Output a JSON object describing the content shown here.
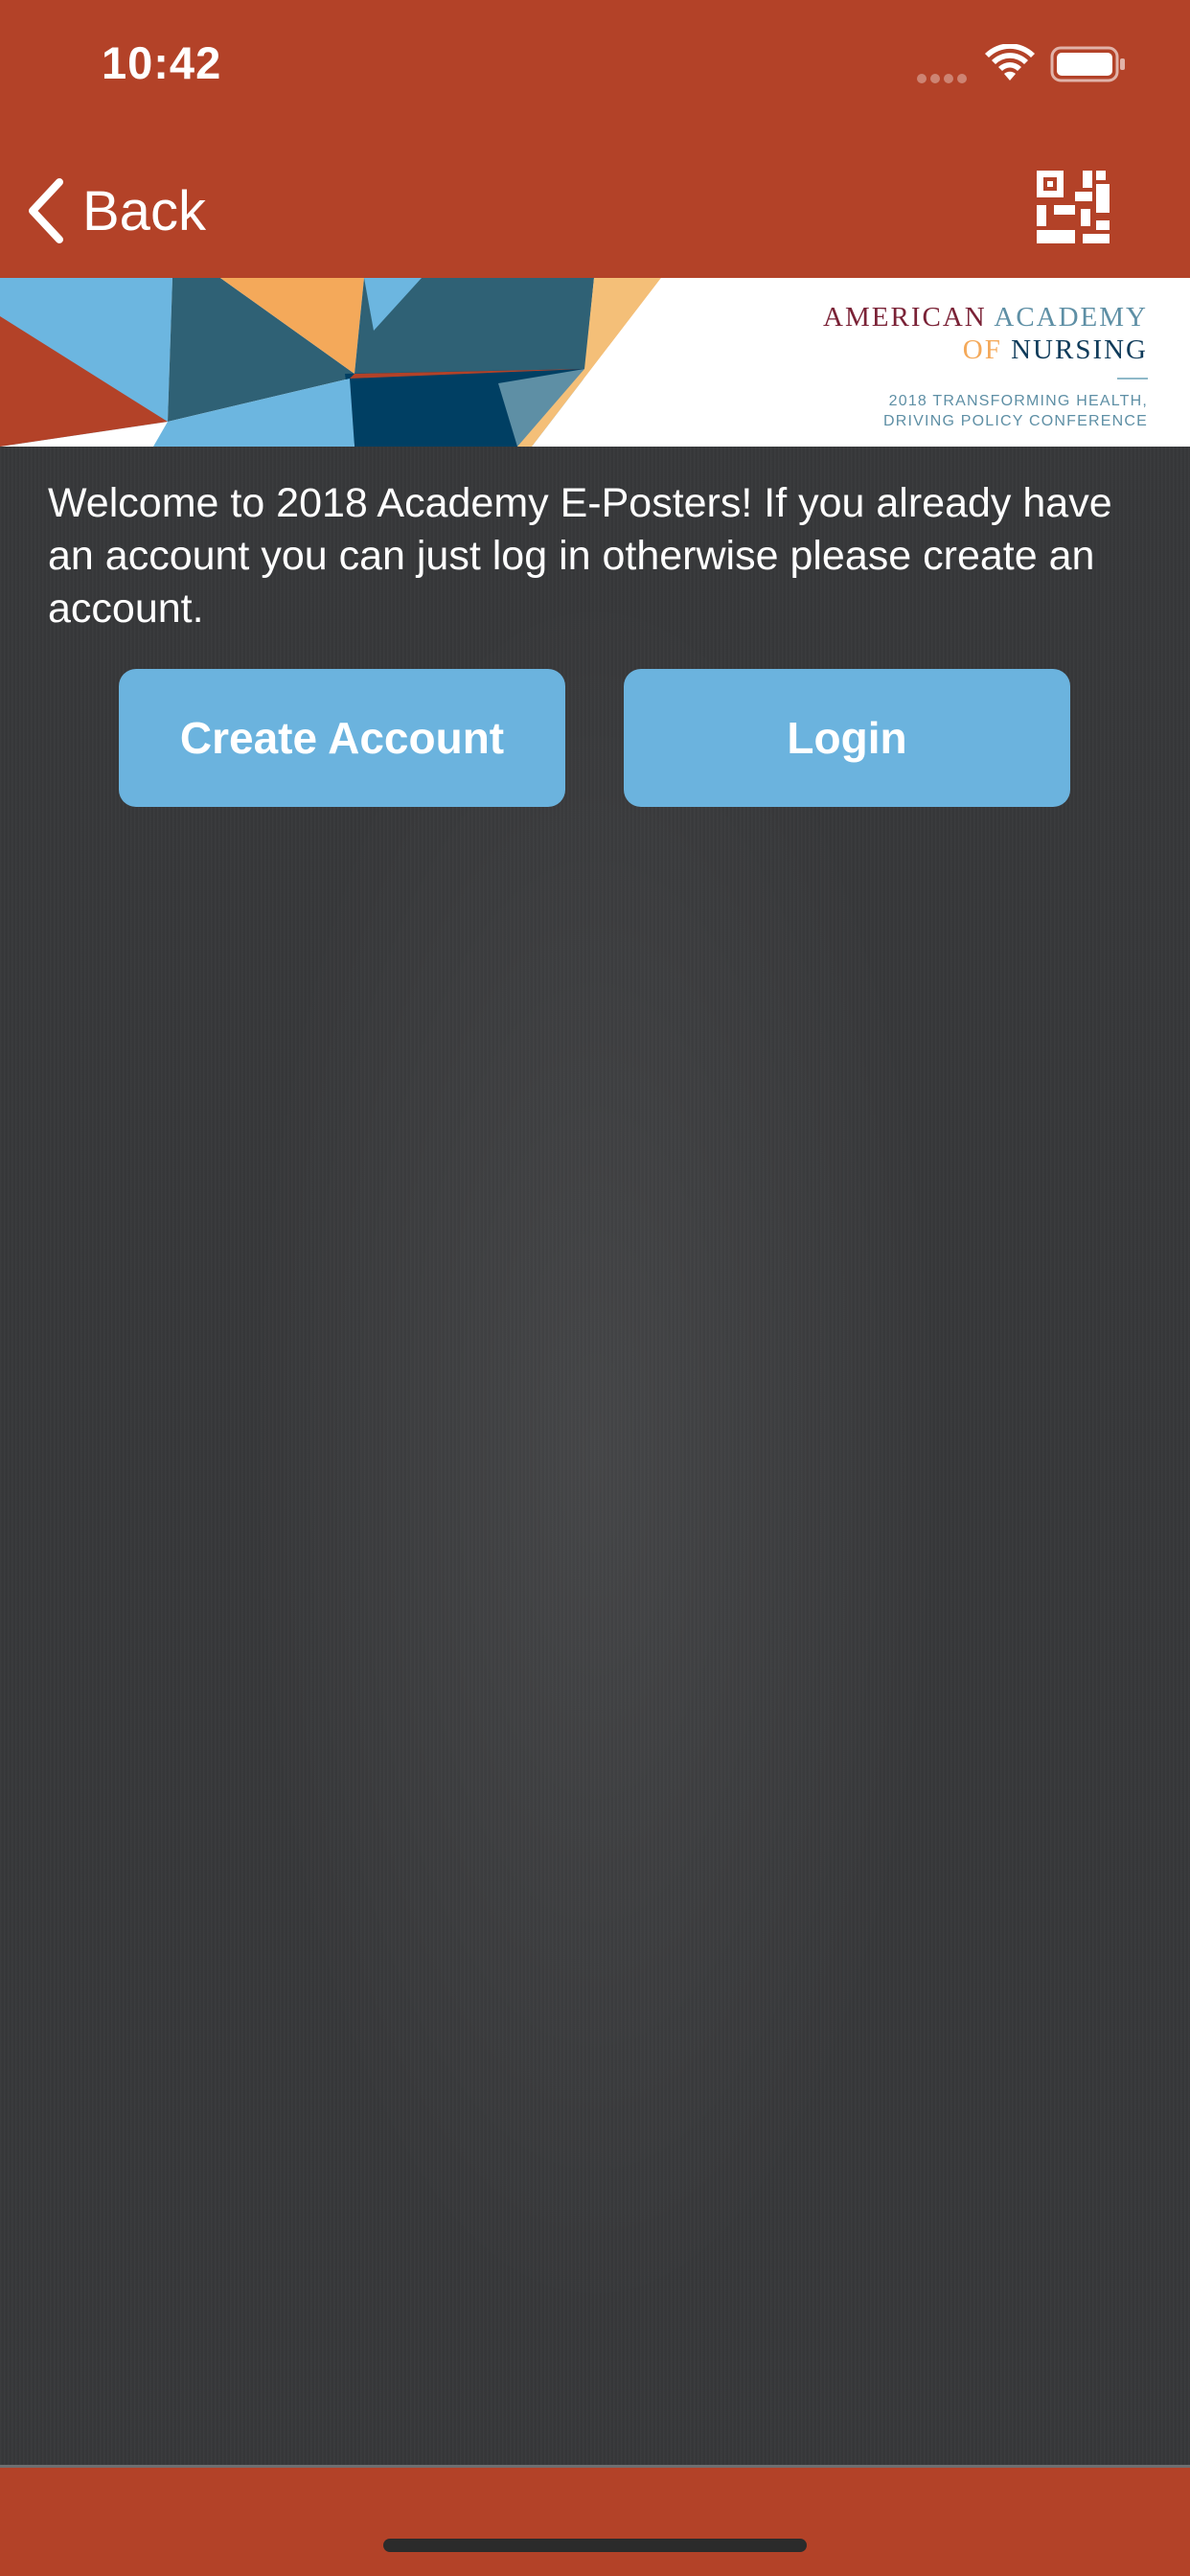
{
  "status_bar": {
    "time": "10:42",
    "icons": [
      "signal-dots-icon",
      "wifi-icon",
      "battery-icon"
    ]
  },
  "nav": {
    "back_label": "Back",
    "back_icon": "chevron-left-icon",
    "qr_icon": "qr-code-icon"
  },
  "banner": {
    "logo_line1_a": "AMERICAN",
    "logo_line1_b": "ACADEMY",
    "logo_line2_a": "OF",
    "logo_line2_b": "NURSING",
    "logo_sub1": "2018 TRANSFORMING HEALTH,",
    "logo_sub2": "DRIVING POLICY CONFERENCE"
  },
  "main": {
    "welcome": "Welcome to 2018 Academy E-Posters!  If you already have an account you can just log in otherwise please create an account.",
    "create_account_label": "Create Account",
    "login_label": "Login"
  },
  "colors": {
    "header": "#b34228",
    "button": "#6bb3de",
    "background": "#37383a",
    "logo_maroon": "#7a2236",
    "logo_teal": "#5e8fa5",
    "logo_orange": "#f4a95a",
    "logo_navy": "#0f3b5a"
  }
}
